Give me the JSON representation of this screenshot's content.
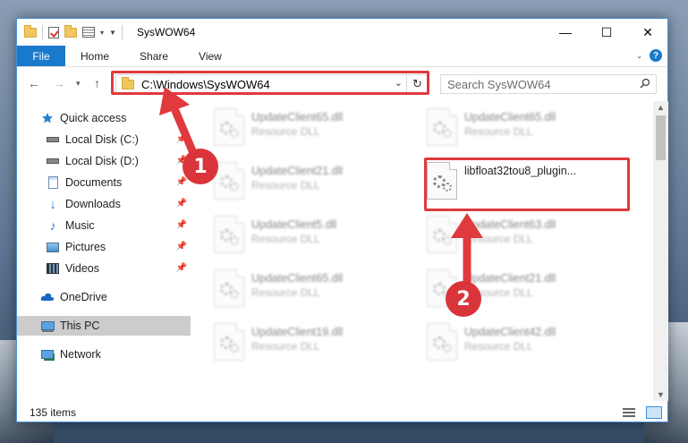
{
  "window": {
    "title": "SysWOW64"
  },
  "controls": {
    "minimize": "—",
    "maximize": "☐",
    "close": "✕"
  },
  "ribbon": {
    "tabs": [
      "File",
      "Home",
      "Share",
      "View"
    ],
    "help": "?"
  },
  "address": {
    "path": "C:\\Windows\\SysWOW64"
  },
  "search": {
    "placeholder": "Search SysWOW64"
  },
  "sidebar": {
    "items": [
      {
        "label": "Quick access",
        "icon": "star-icon"
      },
      {
        "label": "Local Disk (C:)",
        "icon": "drive-icon"
      },
      {
        "label": "Local Disk (D:)",
        "icon": "drive-icon"
      },
      {
        "label": "Documents",
        "icon": "documents-icon"
      },
      {
        "label": "Downloads",
        "icon": "downloads-icon"
      },
      {
        "label": "Music",
        "icon": "music-icon"
      },
      {
        "label": "Pictures",
        "icon": "pictures-icon"
      },
      {
        "label": "Videos",
        "icon": "videos-icon"
      },
      {
        "label": "OneDrive",
        "icon": "cloud-icon"
      },
      {
        "label": "This PC",
        "icon": "computer-icon"
      },
      {
        "label": "Network",
        "icon": "network-icon"
      }
    ]
  },
  "files": [
    {
      "name": "UpdateClient65.dll",
      "type": "Resource DLL"
    },
    {
      "name": "UpdateClient65.dll",
      "type": "Resource DLL"
    },
    {
      "name": "UpdateClient21.dll",
      "type": "Resource DLL"
    },
    {
      "name": "libfloat32tou8_plugin...",
      "type": ""
    },
    {
      "name": "UpdateClient5.dll",
      "type": "Resource DLL"
    },
    {
      "name": "UpdateClient63.dll",
      "type": "Resource DLL"
    },
    {
      "name": "UpdateClient65.dll",
      "type": "Resource DLL"
    },
    {
      "name": "UpdateClient21.dll",
      "type": "Resource DLL"
    },
    {
      "name": "UpdateClient19.dll",
      "type": "Resource DLL"
    },
    {
      "name": "UpdateClient42.dll",
      "type": "Resource DLL"
    }
  ],
  "status": {
    "item_count": "135 items"
  },
  "annotations": {
    "step1": "1",
    "step2": "2",
    "highlight_color": "#e0393e"
  }
}
